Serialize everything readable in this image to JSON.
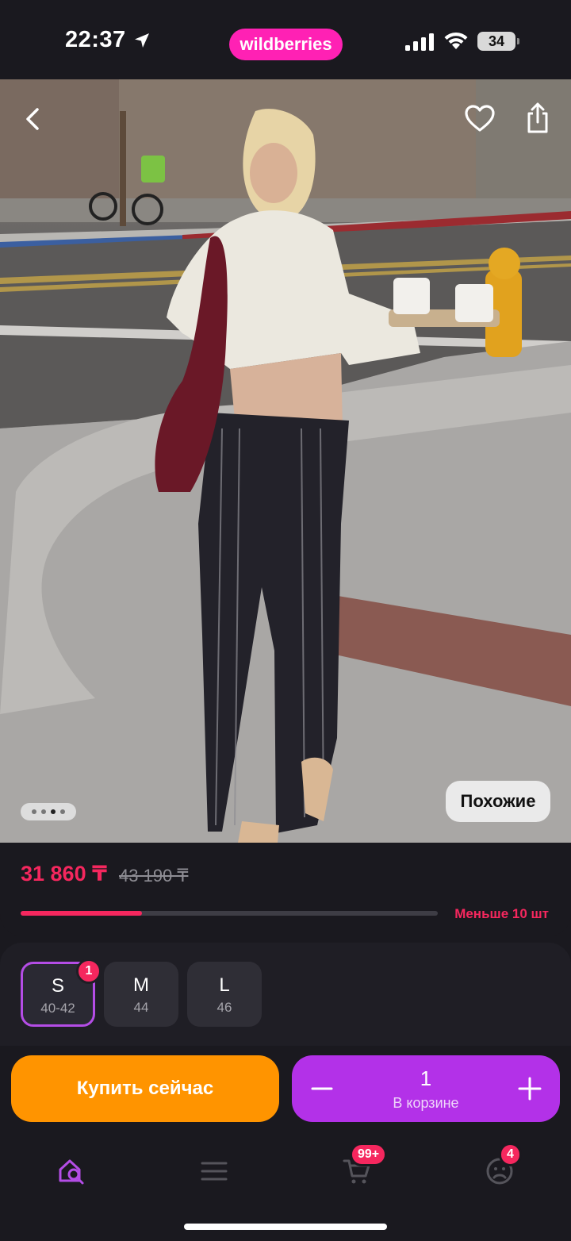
{
  "status_bar": {
    "time": "22:37",
    "battery": "34"
  },
  "brand": {
    "name": "wildberries"
  },
  "photo": {
    "similar_label": "Похожие",
    "carousel": {
      "count": 4,
      "active_index": 2
    }
  },
  "price": {
    "current": "31 860 ₸",
    "old": "43 190 ₸",
    "stock_label": "Меньше 10 шт",
    "stock_level": 0.29
  },
  "sizes": [
    {
      "name": "S",
      "range": "40-42",
      "selected": true,
      "badge": "1"
    },
    {
      "name": "M",
      "range": "44",
      "selected": false
    },
    {
      "name": "L",
      "range": "46",
      "selected": false
    }
  ],
  "actions": {
    "buy_now_label": "Купить сейчас",
    "cart_quantity": "1",
    "cart_label": "В корзине"
  },
  "tab_bar": {
    "items": [
      {
        "id": "home",
        "icon": "home-search-icon",
        "active": true
      },
      {
        "id": "catalog",
        "icon": "menu-icon",
        "active": false
      },
      {
        "id": "cart",
        "icon": "cart-icon",
        "badge": "99+"
      },
      {
        "id": "profile",
        "icon": "profile-icon",
        "badge": "4"
      }
    ]
  },
  "colors": {
    "accent_pink": "#f5275e",
    "brand_pink": "#ff21b4",
    "buy_orange": "#ff9400",
    "cart_purple": "#b331e8",
    "active_tab": "#b44de6"
  }
}
